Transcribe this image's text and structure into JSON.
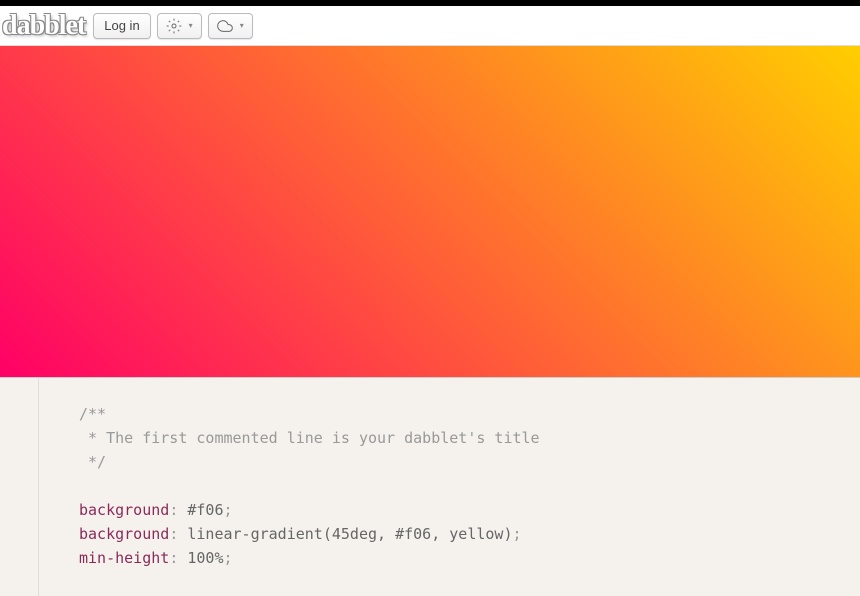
{
  "header": {
    "logo": "dabblet",
    "login_label": "Log in"
  },
  "code": {
    "comment_line1": "/**",
    "comment_line2": " * The first commented line is your dabblet's title",
    "comment_line3": " */",
    "prop1": "background",
    "val1": " #f06",
    "prop2": "background",
    "val2": " linear-gradient(45deg, #f06, yellow)",
    "prop3": "min-height",
    "val3": " 100%"
  },
  "colors": {
    "gradient_start": "#f06",
    "gradient_end": "yellow"
  }
}
